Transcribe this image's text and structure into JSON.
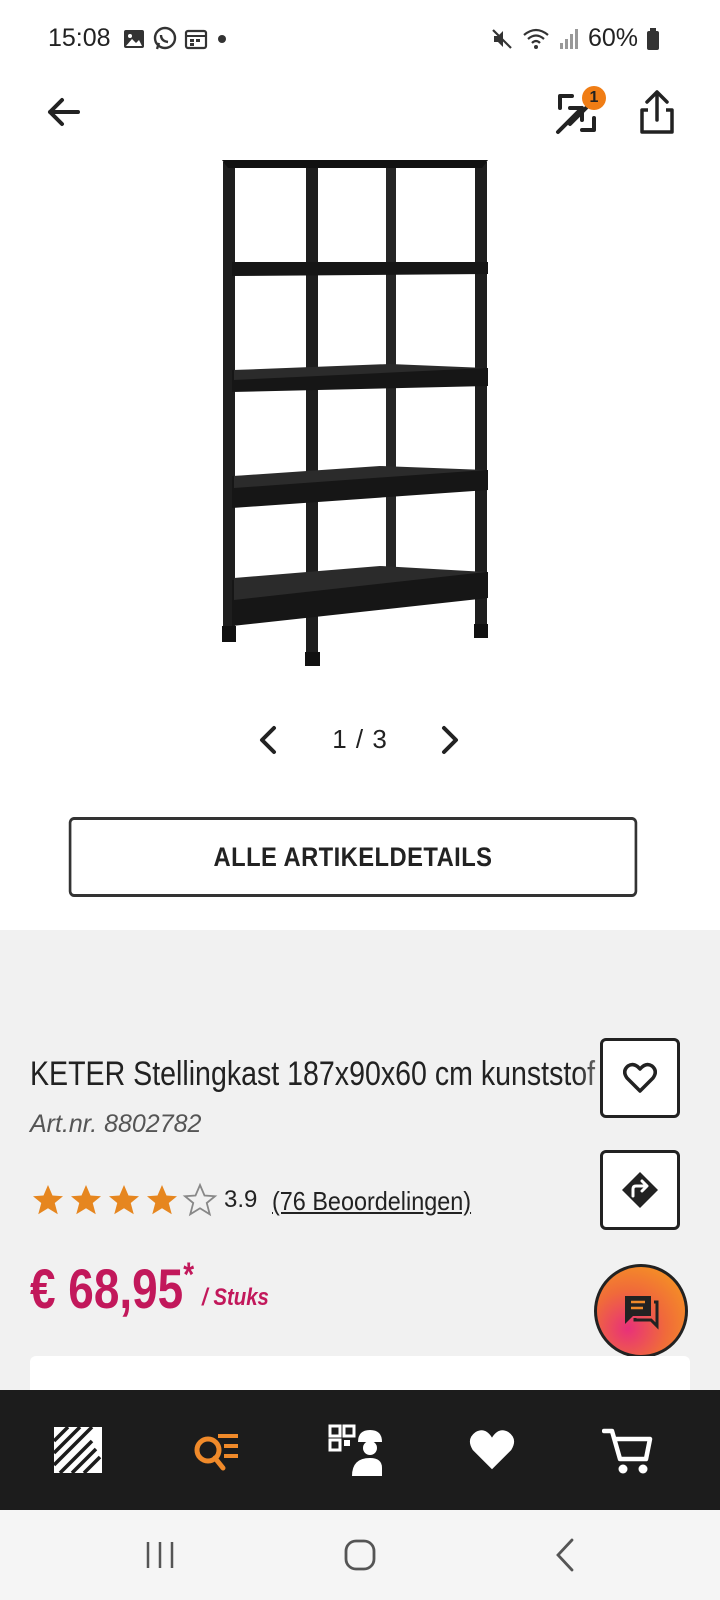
{
  "status_bar": {
    "time": "15:08",
    "battery": "60%",
    "left_icons": [
      "gallery-icon",
      "whatsapp-icon",
      "calendar-icon",
      "dot-icon"
    ],
    "right_icons": [
      "mute-icon",
      "wifi-icon",
      "signal-icon",
      "battery-icon"
    ]
  },
  "top_bar": {
    "compare_badge": "1"
  },
  "gallery": {
    "pager": "1 / 3"
  },
  "details_button": {
    "label": "ALLE ARTIKELDETAILS"
  },
  "product": {
    "title": "KETER Stellingkast 187x90x60 cm kunststof",
    "art_nr": "Art.nr. 8802782",
    "rating_value": "3.9",
    "rating_fraction": 0.78,
    "reviews_link": "(76 Beoordelingen)",
    "price": "€ 68,95",
    "price_asterisk": "*",
    "price_unit": "/ Stuks"
  },
  "colors": {
    "accent_orange": "#f07d15",
    "price_magenta": "#c2185b",
    "nav_dark": "#1c1c1c",
    "panel_grey": "#f1f1f1"
  },
  "bottom_nav": {
    "items": [
      "home-logo-icon",
      "search-list-icon",
      "qr-worker-icon",
      "heart-icon",
      "cart-icon"
    ],
    "active_index": 1
  }
}
